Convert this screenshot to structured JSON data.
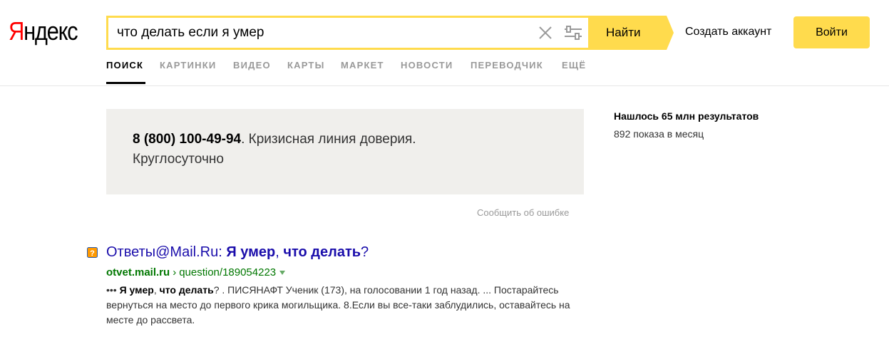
{
  "logo": {
    "first_letter": "Я",
    "rest": "ндекс"
  },
  "search": {
    "query": "что делать если я умер",
    "find_label": "Найти"
  },
  "header": {
    "create_account": "Создать аккаунт",
    "login": "Войти"
  },
  "tabs": [
    {
      "label": "ПОИСК",
      "active": true
    },
    {
      "label": "КАРТИНКИ"
    },
    {
      "label": "ВИДЕО"
    },
    {
      "label": "КАРТЫ"
    },
    {
      "label": "МАРКЕТ"
    },
    {
      "label": "НОВОСТИ"
    },
    {
      "label": "ПЕРЕВОДЧИК"
    },
    {
      "label": "ЕЩЁ"
    }
  ],
  "crisis": {
    "phone": "8 (800) 100-49-94",
    "line1_rest": ". Кризисная линия доверия.",
    "line2": "Круглосуточно",
    "report_error": "Сообщить об ошибке"
  },
  "stats": {
    "found": "Нашлось 65 млн результатов",
    "views": "892 показа в месяц"
  },
  "results": [
    {
      "title_site": "Ответы@Mail.Ru: ",
      "title_bold_1": "Я умер",
      "title_comma": ", ",
      "title_bold_2": "что делать",
      "title_end": "?",
      "url_domain": "otvet.mail.ru",
      "url_sep": "›",
      "url_path": "question/189054223",
      "snippet_prefix": "••• ",
      "snippet_b1": "Я умер",
      "snippet_comma": ", ",
      "snippet_b2": "что делать",
      "snippet_rest": "? . ПИСЯНАФТ Ученик (173), на голосовании 1 год назад. ... Постарайтесь вернуться на место до первого крика могильщика. 8.Если вы все-таки заблудились, оставайтесь на месте до рассвета."
    }
  ],
  "colors": {
    "accent": "#ffdb4d",
    "link": "#1a0dab",
    "url": "#007700",
    "logo_red": "#ff0000"
  }
}
